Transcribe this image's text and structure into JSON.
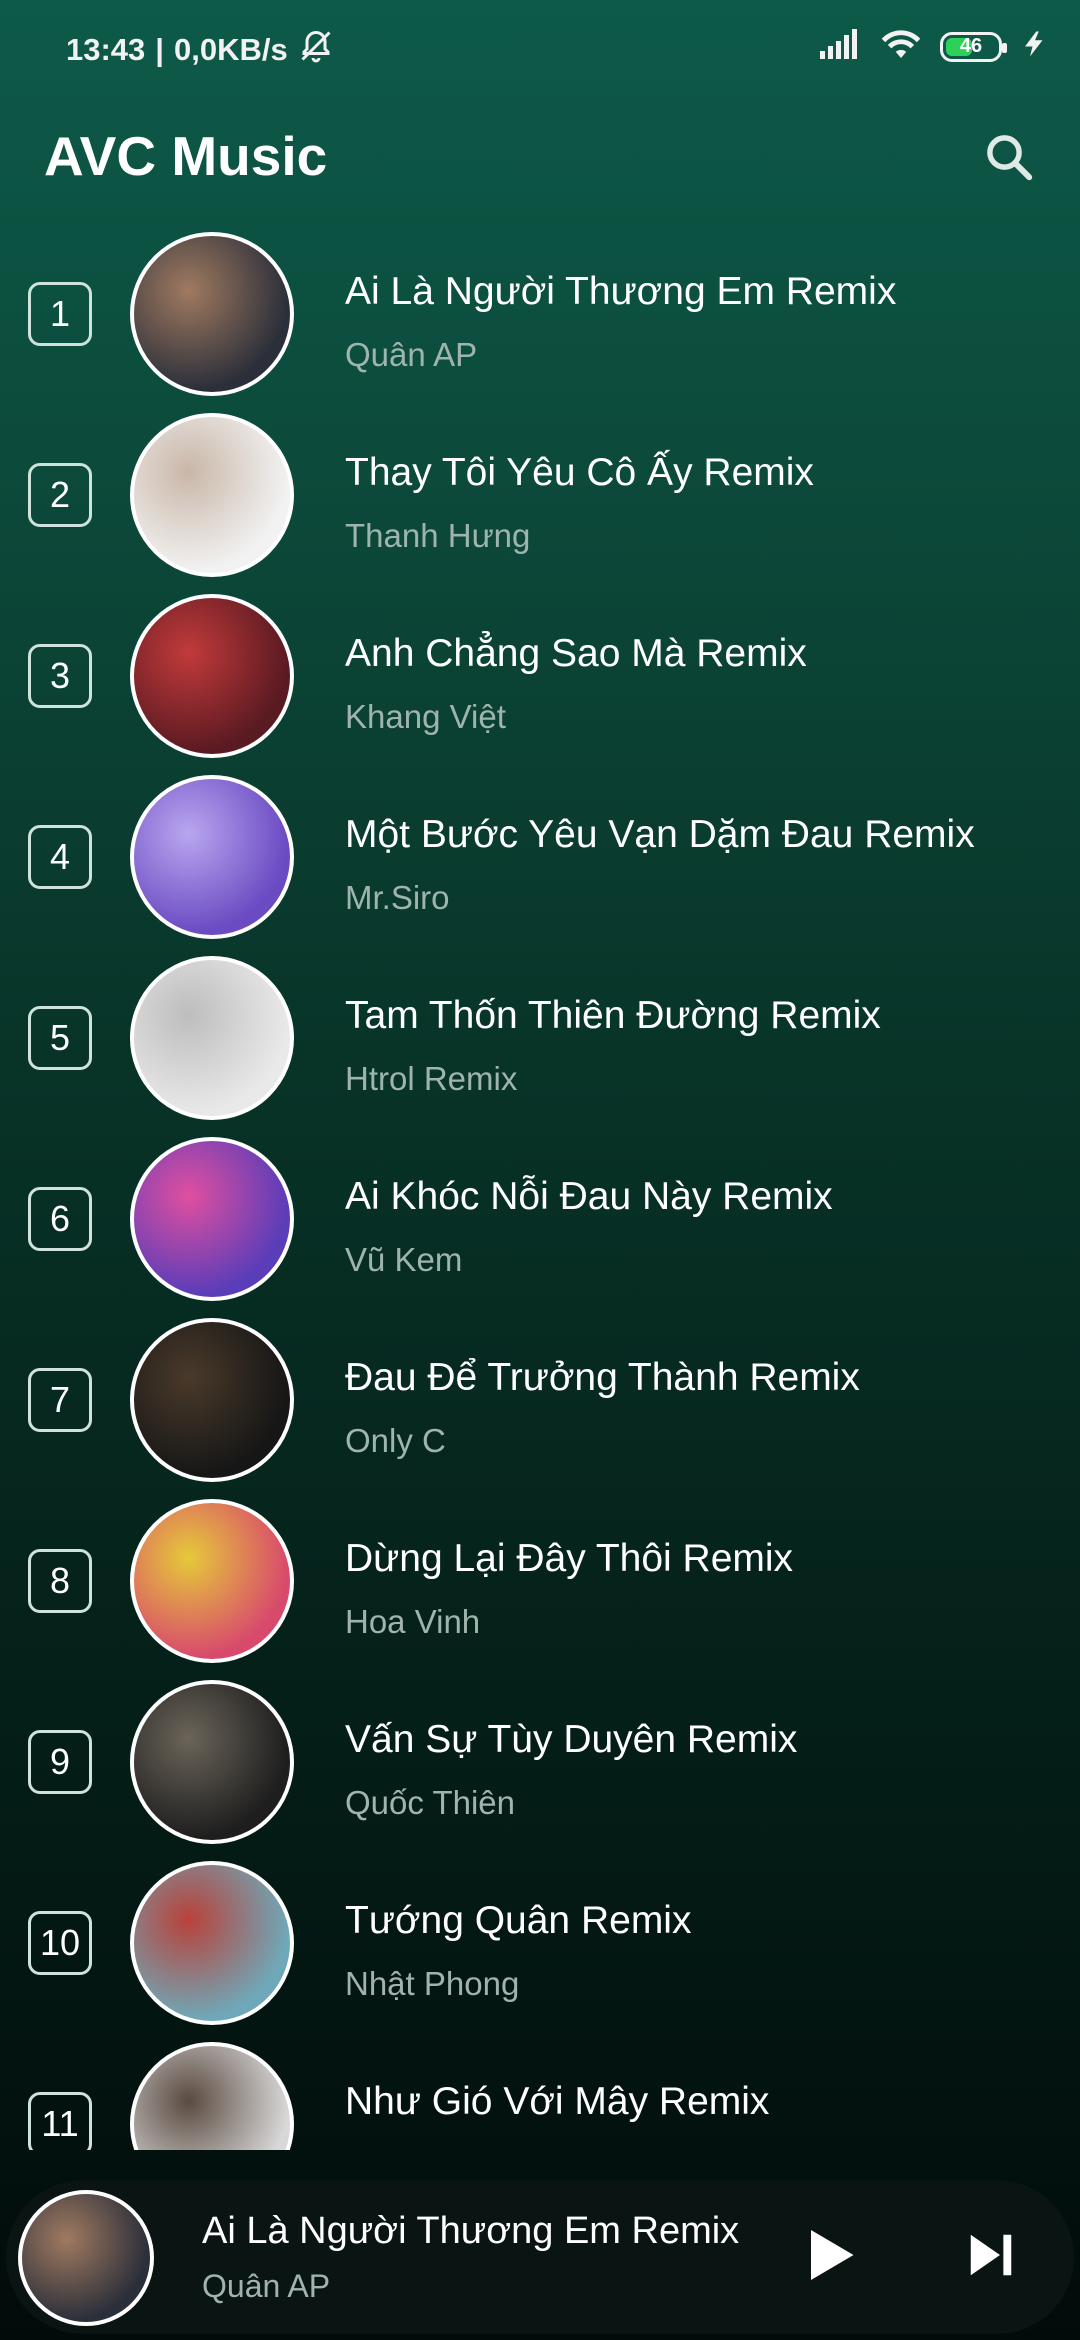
{
  "status_bar": {
    "time": "13:43",
    "separator": "|",
    "speed": "0,0KB/s",
    "battery_level": "46",
    "icons": [
      "alarm-off-icon",
      "signal-icon",
      "wifi-icon",
      "battery-icon",
      "charging-icon"
    ]
  },
  "header": {
    "title": "AVC Music",
    "search_icon": "search-icon"
  },
  "songs": [
    {
      "rank": "1",
      "title": "Ai Là Người Thương Em Remix",
      "artist": "Quân AP",
      "cover_colors": [
        "#2b2f3a",
        "#a07a60"
      ]
    },
    {
      "rank": "2",
      "title": "Thay Tôi Yêu Cô Ấy Remix",
      "artist": "Thanh Hưng",
      "cover_colors": [
        "#f2f2f2",
        "#c9b7a8"
      ]
    },
    {
      "rank": "3",
      "title": "Anh Chẳng Sao Mà Remix",
      "artist": "Khang Việt",
      "cover_colors": [
        "#5a1a22",
        "#c23a3a"
      ]
    },
    {
      "rank": "4",
      "title": "Một Bước Yêu Vạn Dặm Đau Remix",
      "artist": "Mr.Siro",
      "cover_colors": [
        "#6a4bc2",
        "#b9a6ef"
      ]
    },
    {
      "rank": "5",
      "title": "Tam Thốn Thiên Đường Remix",
      "artist": "Htrol Remix",
      "cover_colors": [
        "#e9e9e9",
        "#bdbdbd"
      ]
    },
    {
      "rank": "6",
      "title": "Ai Khóc Nỗi Đau Này Remix",
      "artist": "Vũ Kem",
      "cover_colors": [
        "#5a3db8",
        "#e04fa0"
      ]
    },
    {
      "rank": "7",
      "title": "Đau Để Trưởng Thành Remix",
      "artist": "Only C",
      "cover_colors": [
        "#161616",
        "#4a3a2a"
      ]
    },
    {
      "rank": "8",
      "title": "Dừng Lại Đây Thôi Remix",
      "artist": "Hoa Vinh",
      "cover_colors": [
        "#d84a6c",
        "#e6c93a"
      ]
    },
    {
      "rank": "9",
      "title": "Vấn Sự Tùy Duyên Remix",
      "artist": "Quốc Thiên",
      "cover_colors": [
        "#1e1e1e",
        "#6b6459"
      ]
    },
    {
      "rank": "10",
      "title": "Tướng Quân Remix",
      "artist": "Nhật Phong",
      "cover_colors": [
        "#6fa8b8",
        "#b8423a"
      ]
    },
    {
      "rank": "11",
      "title": "Như Gió Với Mây Remix",
      "artist": "",
      "cover_colors": [
        "#d8d8d8",
        "#5a4a40"
      ]
    }
  ],
  "now_playing": {
    "title": "Ai Là Người Thương Em Remix",
    "artist": "Quân AP",
    "cover_colors": [
      "#2b2f3a",
      "#a07a60"
    ],
    "play_icon": "play-icon",
    "next_icon": "skip-next-icon"
  },
  "colors": {
    "bg_top": "#0d5a49",
    "bg_bottom": "#020b0a",
    "artist_text": "#9fb4ad",
    "player_bg": "#0a1413",
    "battery_fill": "#2ed158"
  }
}
